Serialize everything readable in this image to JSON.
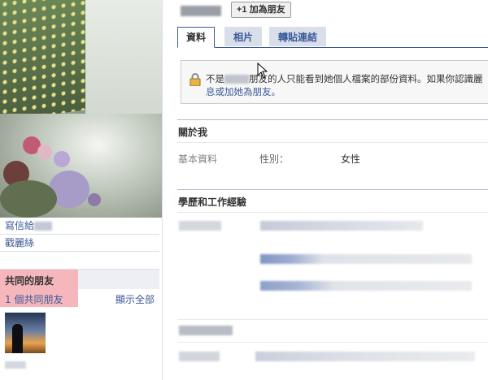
{
  "header": {
    "add_friend_label": "+1 加為朋友"
  },
  "tabs": [
    {
      "label": "資料",
      "active": true
    },
    {
      "label": "相片",
      "active": false
    },
    {
      "label": "轉貼連結",
      "active": false
    }
  ],
  "notice": {
    "line1_prefix": "不是",
    "line1_suffix": "朋友的人只能看到她個人檔案的部份資料。如果你認識麗",
    "line2": "息或加她為朋友。"
  },
  "left": {
    "write_to_label": "寫信給",
    "fan_label": "戳麗絲",
    "mutual_title": "共同的朋友",
    "mutual_count": "1 個共同朋友",
    "show_all": "顯示全部"
  },
  "about": {
    "title": "關於我",
    "basic_label": "基本資料",
    "gender_label": "性別：",
    "gender_value": "女性"
  },
  "education": {
    "title": "學歷和工作經驗"
  },
  "colors": {
    "link": "#3b5998",
    "tab_bg": "#d8dfea",
    "highlight": "#f5b6bc"
  }
}
